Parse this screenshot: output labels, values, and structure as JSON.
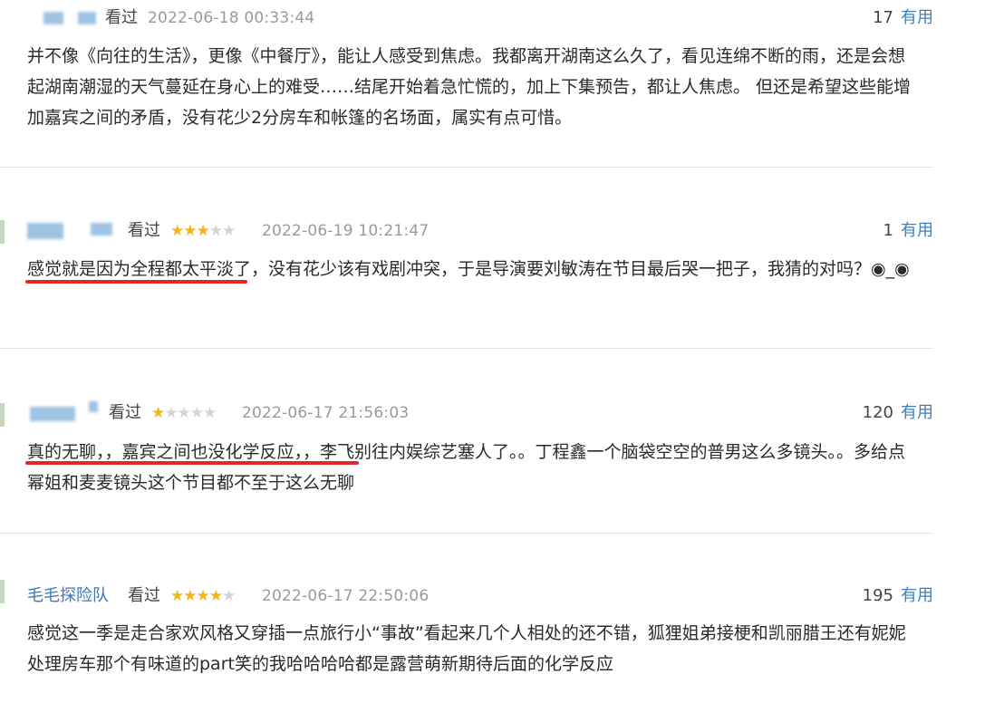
{
  "ui": {
    "useful_word": "有用",
    "watched_label": "看过"
  },
  "reviews": [
    {
      "username": "",
      "rating": 0,
      "date": "2022-06-18 00:33:44",
      "useful_count": "17",
      "text": "并不像《向往的生活》，更像《中餐厅》，能让人感受到焦虑。我都离开湖南这么久了，看见连绵不断的雨，还是会想起湖南潮湿的天气蔓延在身心上的难受……结尾开始着急忙慌的，加上下集预告，都让人焦虑。 但还是希望这些能增加嘉宾之间的矛盾，没有花少2分房车和帐篷的名场面，属实有点可惜。"
    },
    {
      "username": "",
      "rating": 3,
      "date": "2022-06-19 10:21:47",
      "useful_count": "1",
      "text": "感觉就是因为全程都太平淡了，没有花少该有戏剧冲突，于是导演要刘敏涛在节目最后哭一把子，我猜的对吗？◉_◉"
    },
    {
      "username": "",
      "rating": 1,
      "date": "2022-06-17 21:56:03",
      "useful_count": "120",
      "text": "真的无聊，，嘉宾之间也没化学反应，，李飞别往内娱综艺塞人了。。丁程鑫一个脑袋空空的普男这么多镜头。。多给点幂姐和麦麦镜头这个节目都不至于这么无聊"
    },
    {
      "username": "毛毛探险队",
      "rating": 4,
      "date": "2022-06-17 22:50:06",
      "useful_count": "195",
      "text": "感觉这一季是走合家欢风格又穿插一点旅行小“事故”看起来几个人相处的还不错，狐狸姐弟接梗和凯丽腊王还有妮妮处理房车那个有味道的part笑的我哈哈哈哈都是露营萌新期待后面的化学反应"
    }
  ],
  "colors": {
    "star_on": "#f4b41a",
    "star_off": "#d4d4d4",
    "link": "#3a7fc4",
    "highlight": "#e32626"
  }
}
